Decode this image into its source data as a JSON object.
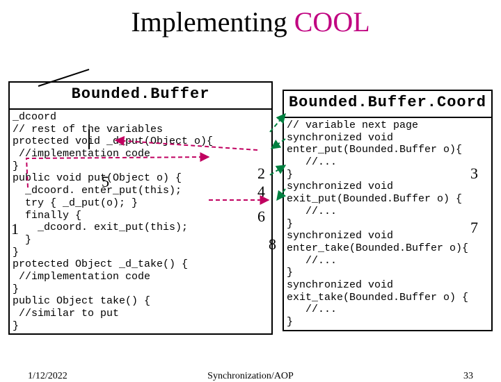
{
  "title": {
    "prefix": "Implementing ",
    "cool": "COOL"
  },
  "left": {
    "header": "Bounded.Buffer",
    "code": "_dcoord\n// rest of the variables\nprotected void _d_put(Object o){\n //implementation code\n}\npublic void put(Object o) {\n  _dcoord. enter_put(this);\n  try { _d_put(o); }\n  finally {\n    _dcoord. exit_put(this);\n  }\n}\nprotected Object _d_take() {\n //implementation code\n}\npublic Object take() {\n //similar to put\n}"
  },
  "right": {
    "header": "Bounded.Buffer.Coord",
    "code": "// variable next page\nsynchronized void\nenter_put(Bounded.Buffer o){\n   //...\n}\nsynchronized void\nexit_put(Bounded.Buffer o) {\n   //...\n}\nsynchronized void\nenter_take(Bounded.Buffer o){\n   //...\n}\nsynchronized void\nexit_take(Bounded.Buffer o) {\n   //...\n}"
  },
  "numbers": {
    "n1": "1",
    "n2": "2",
    "n3": "3",
    "n4": "4",
    "n5": "5",
    "n6": "6",
    "n7": "7",
    "n8": "8"
  },
  "footer": {
    "date": "1/12/2022",
    "center": "Synchronization/AOP",
    "page": "33"
  }
}
